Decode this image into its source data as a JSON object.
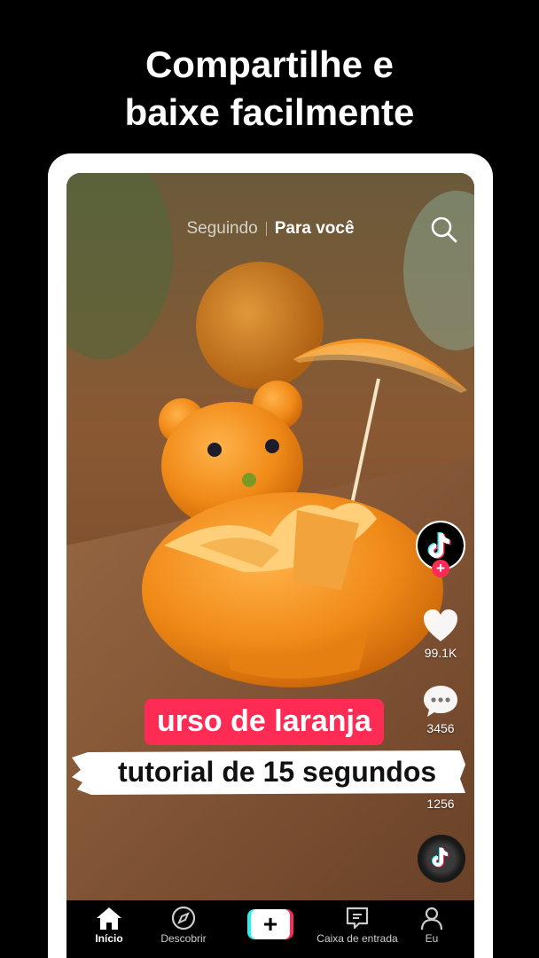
{
  "headline": {
    "line1": "Compartilhe e",
    "line2": "baixe facilmente"
  },
  "feed_tabs": {
    "following": "Seguindo",
    "for_you": "Para você"
  },
  "actions": {
    "likes": "99.1K",
    "comments": "3456",
    "shares": "1256"
  },
  "captions": {
    "title": "urso de laranja",
    "subtitle": "tutorial de 15 segundos"
  },
  "bottom_nav": {
    "home": "Início",
    "discover": "Descobrir",
    "create": "+",
    "inbox": "Caixa de entrada",
    "me": "Eu"
  },
  "colors": {
    "accent_pink": "#fe2c55",
    "accent_cyan": "#25f4ee",
    "nav_background": "#000000"
  },
  "icons": [
    "search-icon",
    "tiktok-logo-icon",
    "heart-icon",
    "comment-icon",
    "share-icon",
    "music-disc-icon",
    "home-icon",
    "compass-icon",
    "inbox-icon",
    "profile-icon"
  ]
}
